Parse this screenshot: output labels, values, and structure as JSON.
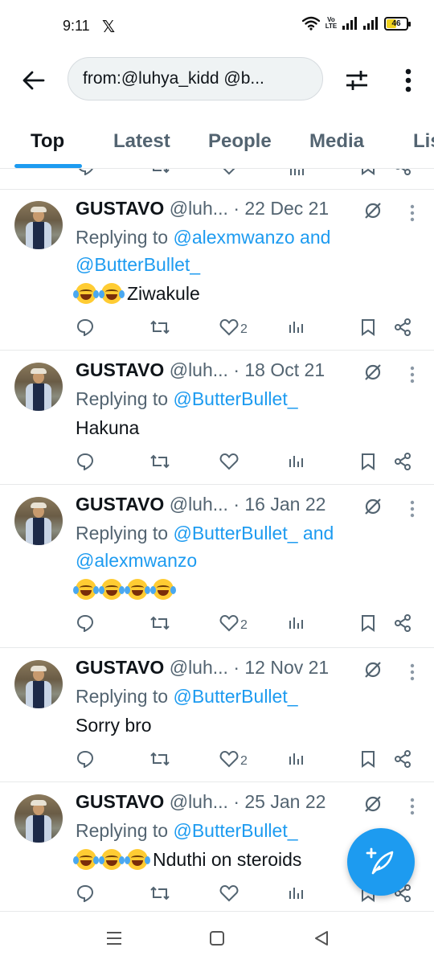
{
  "status_bar": {
    "time": "9:11",
    "app_glyph": "𝕏",
    "battery": "46",
    "network_label": "Vo LTE"
  },
  "search": {
    "query": "from:@luhya_kidd @b..."
  },
  "tabs": [
    {
      "label": "Top",
      "active": true
    },
    {
      "label": "Latest",
      "active": false
    },
    {
      "label": "People",
      "active": false
    },
    {
      "label": "Media",
      "active": false
    },
    {
      "label": "Lis",
      "active": false
    }
  ],
  "tweets": [
    {
      "name": "GUSTAVO",
      "handle": "@luh...",
      "date": "· 22 Dec 21",
      "reply_prefix": "Replying to ",
      "mention_1": "@alexmwanzo",
      "joiner": " and",
      "mention_2": "@ButterBullet_",
      "emoji_count": 2,
      "text": "Ziwakule",
      "likes": "2"
    },
    {
      "name": "GUSTAVO",
      "handle": "@luh...",
      "date": "· 18 Oct 21",
      "reply_prefix": "Replying to ",
      "mention_1": "@ButterBullet_",
      "joiner": "",
      "mention_2": "",
      "emoji_count": 0,
      "text": "Hakuna",
      "likes": ""
    },
    {
      "name": "GUSTAVO",
      "handle": "@luh...",
      "date": "· 16 Jan 22",
      "reply_prefix": "Replying to ",
      "mention_1": "@ButterBullet_",
      "joiner": " and",
      "mention_2": "@alexmwanzo",
      "emoji_count": 4,
      "text": "",
      "likes": "2"
    },
    {
      "name": "GUSTAVO",
      "handle": "@luh...",
      "date": "· 12 Nov 21",
      "reply_prefix": "Replying to ",
      "mention_1": "@ButterBullet_",
      "joiner": "",
      "mention_2": "",
      "emoji_count": 0,
      "text": "Sorry bro",
      "likes": "2"
    },
    {
      "name": "GUSTAVO",
      "handle": "@luh...",
      "date": "· 25 Jan 22",
      "reply_prefix": "Replying to ",
      "mention_1": "@ButterBullet_",
      "joiner": "",
      "mention_2": "",
      "emoji_count": 3,
      "text": "Nduthi on steroids",
      "likes": ""
    }
  ],
  "icons": {
    "reply": "reply-icon",
    "retweet": "retweet-icon",
    "like": "heart-icon",
    "views": "views-icon",
    "bookmark": "bookmark-icon",
    "share": "share-icon",
    "grok": "grok-icon",
    "compose": "compose-icon"
  },
  "colors": {
    "accent": "#1d9bf0",
    "text_primary": "#0f1419",
    "text_secondary": "#536471",
    "divider": "#e7e9ea",
    "emoji": "#ffcc33"
  }
}
